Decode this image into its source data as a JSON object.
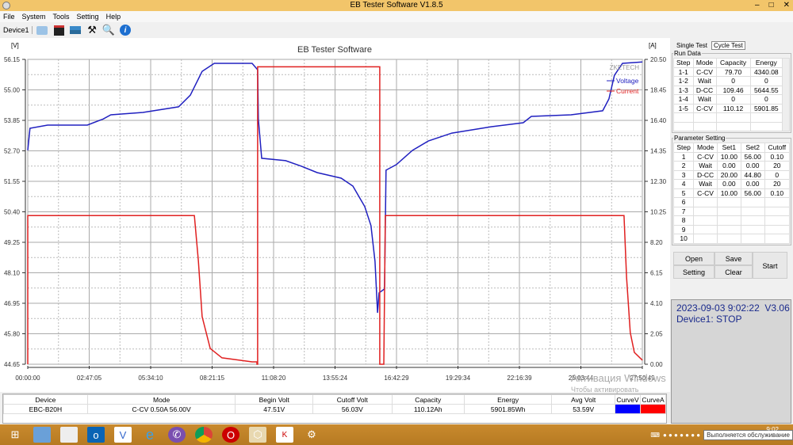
{
  "window": {
    "title": "EB Tester Software V1.8.5",
    "controls": [
      "–",
      "□",
      "✕"
    ]
  },
  "menu": [
    "File",
    "System",
    "Tools",
    "Setting",
    "Help"
  ],
  "toolbar": {
    "device": "Device1",
    "icons": [
      "open-icon",
      "save-icon",
      "chart-icon",
      "tools-icon",
      "search-icon",
      "info-icon"
    ]
  },
  "chart_data": {
    "type": "line",
    "title": "EB Tester Software",
    "watermark": "ZKETECH",
    "ylabel_left": "[V]",
    "ylabel_right": "[A]",
    "ylim_left": [
      44.65,
      56.15
    ],
    "ylim_right": [
      0,
      20.5
    ],
    "yticks_left": [
      "56.15",
      "55.00",
      "53.85",
      "52.70",
      "51.55",
      "50.40",
      "49.25",
      "48.10",
      "46.95",
      "45.80",
      "44.65"
    ],
    "yticks_right": [
      "20.50",
      "18.45",
      "16.40",
      "14.35",
      "12.30",
      "10.25",
      "8.20",
      "6.15",
      "4.10",
      "2.05",
      "0.00"
    ],
    "xticks": [
      "00:00:00",
      "02:47:05",
      "05:34:10",
      "08:21:15",
      "11:08:20",
      "13:55:24",
      "16:42:29",
      "19:29:34",
      "22:16:39",
      "25:03:44",
      "27:50:49"
    ],
    "xlim": [
      "00:00:00",
      "27:50:49"
    ],
    "grid": true,
    "legend": "top-right",
    "series": [
      {
        "name": "Voltage",
        "axis": "left",
        "color": "#2020c0",
        "points": [
          [
            "0:00",
            52.72
          ],
          [
            "0:06",
            53.55
          ],
          [
            "0:54",
            53.67
          ],
          [
            "2:42",
            53.67
          ],
          [
            "3:25",
            53.9
          ],
          [
            "3:46",
            54.06
          ],
          [
            "5:13",
            54.15
          ],
          [
            "6:50",
            54.36
          ],
          [
            "7:22",
            54.8
          ],
          [
            "7:54",
            55.7
          ],
          [
            "8:27",
            56.0
          ],
          [
            "10:10",
            56.0
          ],
          [
            "10:25",
            55.76
          ],
          [
            "10:27",
            53.9
          ],
          [
            "10:36",
            52.42
          ],
          [
            "11:41",
            52.33
          ],
          [
            "12:24",
            52.12
          ],
          [
            "13:07",
            51.88
          ],
          [
            "14:12",
            51.67
          ],
          [
            "14:44",
            51.37
          ],
          [
            "15:16",
            50.6
          ],
          [
            "15:33",
            49.88
          ],
          [
            "15:44",
            48.53
          ],
          [
            "15:51",
            46.59
          ],
          [
            "15:55",
            47.34
          ],
          [
            "16:10",
            47.49
          ],
          [
            "16:14",
            51.97
          ],
          [
            "16:42",
            52.18
          ],
          [
            "17:26",
            52.72
          ],
          [
            "18:09",
            53.07
          ],
          [
            "19:13",
            53.37
          ],
          [
            "21:01",
            53.61
          ],
          [
            "22:27",
            53.76
          ],
          [
            "22:49",
            54.0
          ],
          [
            "24:37",
            54.06
          ],
          [
            "26:03",
            54.21
          ],
          [
            "26:20",
            54.66
          ],
          [
            "26:35",
            55.55
          ],
          [
            "26:57",
            56.0
          ],
          [
            "27:51",
            56.05
          ]
        ]
      },
      {
        "name": "Current",
        "axis": "right",
        "color": "#e02020",
        "points": [
          [
            "0:00",
            0
          ],
          [
            "0:00",
            10
          ],
          [
            "7:33",
            10
          ],
          [
            "7:44",
            6.92
          ],
          [
            "7:54",
            3.2
          ],
          [
            "8:16",
            1.06
          ],
          [
            "8:48",
            0.43
          ],
          [
            "10:10",
            0.16
          ],
          [
            "10:23",
            0.16
          ],
          [
            "10:23",
            0
          ],
          [
            "10:25",
            0
          ],
          [
            "10:25",
            20
          ],
          [
            "15:57",
            20
          ],
          [
            "15:57",
            0
          ],
          [
            "16:08",
            0
          ],
          [
            "16:12",
            10
          ],
          [
            "27:01",
            10
          ],
          [
            "27:08",
            5.86
          ],
          [
            "27:18",
            2.13
          ],
          [
            "27:29",
            0.8
          ],
          [
            "27:51",
            0.27
          ]
        ]
      }
    ]
  },
  "right_panel": {
    "tabs": [
      "Single Test",
      "Cycle Test"
    ],
    "run_data": {
      "title": "Run Data",
      "headers": [
        "Step",
        "Mode",
        "Capacity",
        "Energy"
      ],
      "rows": [
        [
          "1-1",
          "C-CV",
          "79.70",
          "4340.08"
        ],
        [
          "1-2",
          "Wait",
          "0",
          "0"
        ],
        [
          "1-3",
          "D-CC",
          "109.46",
          "5644.55"
        ],
        [
          "1-4",
          "Wait",
          "0",
          "0"
        ],
        [
          "1-5",
          "C-CV",
          "110.12",
          "5901.85"
        ],
        [
          "",
          "",
          "",
          ""
        ],
        [
          "",
          "",
          "",
          ""
        ]
      ]
    },
    "params": {
      "title": "Parameter Setting",
      "headers": [
        "Step",
        "Mode",
        "Set1",
        "Set2",
        "Cutoff"
      ],
      "rows": [
        [
          "1",
          "C-CV",
          "10.00",
          "56.00",
          "0.10"
        ],
        [
          "2",
          "Wait",
          "0.00",
          "0.00",
          "20"
        ],
        [
          "3",
          "D-CC",
          "20.00",
          "44.80",
          "0"
        ],
        [
          "4",
          "Wait",
          "0.00",
          "0.00",
          "20"
        ],
        [
          "5",
          "C-CV",
          "10.00",
          "56.00",
          "0.10"
        ],
        [
          "6",
          "",
          "",
          "",
          ""
        ],
        [
          "7",
          "",
          "",
          "",
          ""
        ],
        [
          "8",
          "",
          "",
          "",
          ""
        ],
        [
          "9",
          "",
          "",
          "",
          ""
        ],
        [
          "10",
          "",
          "",
          "",
          ""
        ]
      ]
    },
    "buttons": {
      "open": "Open",
      "save": "Save",
      "setting": "Setting",
      "clear": "Clear",
      "start": "Start"
    },
    "status": {
      "line1": "2023-09-03 9:02:22  V3.06",
      "line2": "Device1: STOP"
    }
  },
  "bottom_table": {
    "headers": [
      "Device",
      "Mode",
      "Begin Volt",
      "Cutoff Volt",
      "Capacity",
      "Energy",
      "Avg Volt",
      "CurveV",
      "CurveA"
    ],
    "row": [
      "EBC-B20H",
      "C-CV  0.50A  56.00V",
      "47.51V",
      "56.03V",
      "110.12Ah",
      "5901.85Wh",
      "53.59V",
      "",
      ""
    ],
    "curve_colors": [
      "#0000ff",
      "#ff0000"
    ]
  },
  "watermark": {
    "line1": "Активация Windows",
    "line2": "Чтобы активировать Windows, перейдите к параметрам"
  },
  "taskbar": {
    "clock": "9:02",
    "tooltip": "Выполняется обслуживание"
  }
}
